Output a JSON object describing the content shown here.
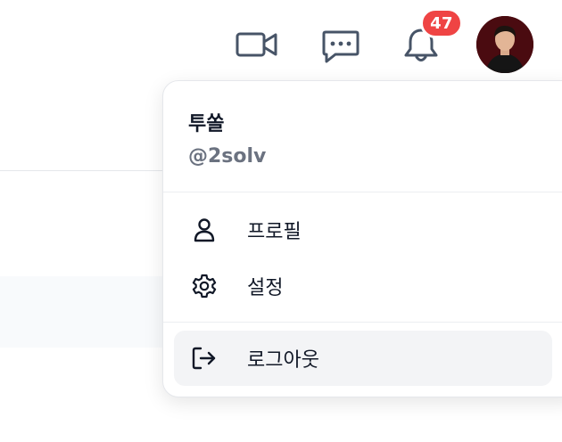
{
  "header": {
    "icons": {
      "video": "video-camera-icon",
      "chat": "chat-dots-icon",
      "bell": "bell-icon"
    },
    "notification_count": "47",
    "avatar": "user-avatar"
  },
  "menu": {
    "user": {
      "name": "투쏠",
      "handle": "@2solv"
    },
    "items": [
      {
        "label": "프로필",
        "icon": "user-icon"
      },
      {
        "label": "설정",
        "icon": "gear-icon"
      },
      {
        "label": "로그아웃",
        "icon": "logout-icon"
      }
    ]
  },
  "colors": {
    "badge": "#ef4444",
    "icon_stroke": "#475467",
    "hover_bg": "#f3f4f6"
  }
}
